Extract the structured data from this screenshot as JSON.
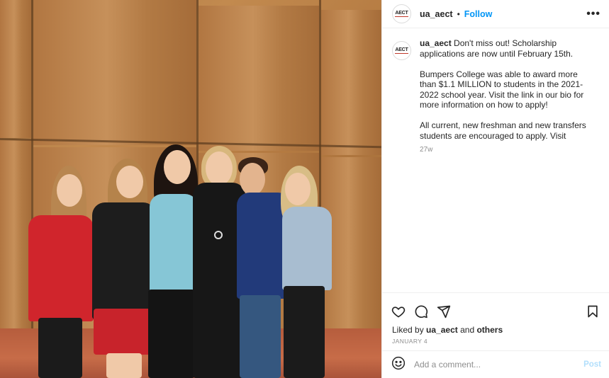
{
  "post": {
    "account": {
      "username": "ua_aect",
      "avatar_text": "AECT",
      "follow_label": "Follow",
      "separator": "•",
      "more_label": "•••"
    },
    "caption": {
      "username": "ua_aect",
      "paragraphs": [
        "Don't miss out! Scholarship applications are now until February 15th.",
        "Bumpers College was able to award more than $1.1 MILLION to students in the 2021-2022 school year. Visit the link in our bio for more information on how to apply!",
        "All current, new freshman and new transfers students are encouraged to apply. Visit"
      ],
      "age": "27w"
    },
    "icons": {
      "like": "heart-icon",
      "comment": "comment-icon",
      "share": "share-icon",
      "save": "bookmark-icon",
      "emoji": "emoji-icon",
      "more": "more-icon"
    },
    "likes": {
      "prefix": "Liked by",
      "user": "ua_aect",
      "conjunction": "and",
      "others": "others"
    },
    "date": "JANUARY 4",
    "comment": {
      "placeholder": "Add a comment...",
      "post_label": "Post"
    },
    "colors": {
      "follow": "#0095f6",
      "post_disabled": "#b2dffc",
      "muted": "#8e8e8e"
    }
  }
}
